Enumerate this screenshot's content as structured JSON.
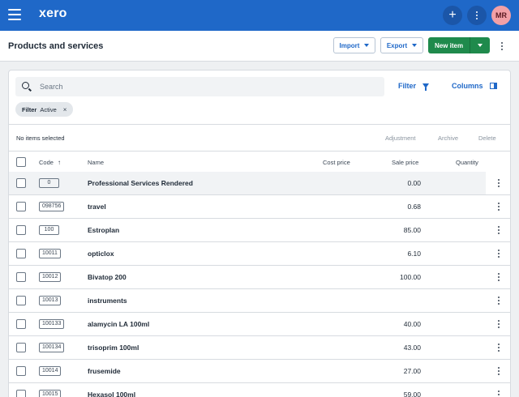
{
  "topbar": {
    "logo": "xero",
    "add_symbol": "+",
    "avatar_initials": "MR"
  },
  "header": {
    "title": "Products and services",
    "import_label": "Import",
    "export_label": "Export",
    "new_item_label": "New item"
  },
  "toolbar": {
    "search_placeholder": "Search",
    "filter_label": "Filter",
    "columns_label": "Columns",
    "chip": {
      "key": "Filter",
      "value": "Active",
      "remove": "×"
    }
  },
  "selection": {
    "label": "No items selected",
    "actions": [
      "Adjustment",
      "Archive",
      "Delete"
    ]
  },
  "table": {
    "columns": {
      "code": "Code",
      "sort_arrow": "↑",
      "name": "Name",
      "cost_price": "Cost price",
      "sale_price": "Sale price",
      "quantity": "Quantity"
    },
    "rows": [
      {
        "code": "0",
        "name": "Professional Services Rendered",
        "sale": "0.00"
      },
      {
        "code": "098756",
        "name": "travel",
        "sale": "0.68"
      },
      {
        "code": "100",
        "name": "Estroplan",
        "sale": "85.00"
      },
      {
        "code": "10011",
        "name": "opticlox",
        "sale": "6.10"
      },
      {
        "code": "10012",
        "name": "Bivatop 200",
        "sale": "100.00"
      },
      {
        "code": "10013",
        "name": "instruments",
        "sale": ""
      },
      {
        "code": "100133",
        "name": "alamycin LA 100ml",
        "sale": "40.00"
      },
      {
        "code": "100134",
        "name": "trisoprim 100ml",
        "sale": "43.00"
      },
      {
        "code": "10014",
        "name": "frusemide",
        "sale": "27.00"
      },
      {
        "code": "10015",
        "name": "Hexasol 100ml",
        "sale": "59.00"
      }
    ]
  },
  "colors": {
    "brand_blue": "#1f68c8",
    "primary_green": "#1f8a4c",
    "avatar_bg": "#f2a0a6"
  }
}
